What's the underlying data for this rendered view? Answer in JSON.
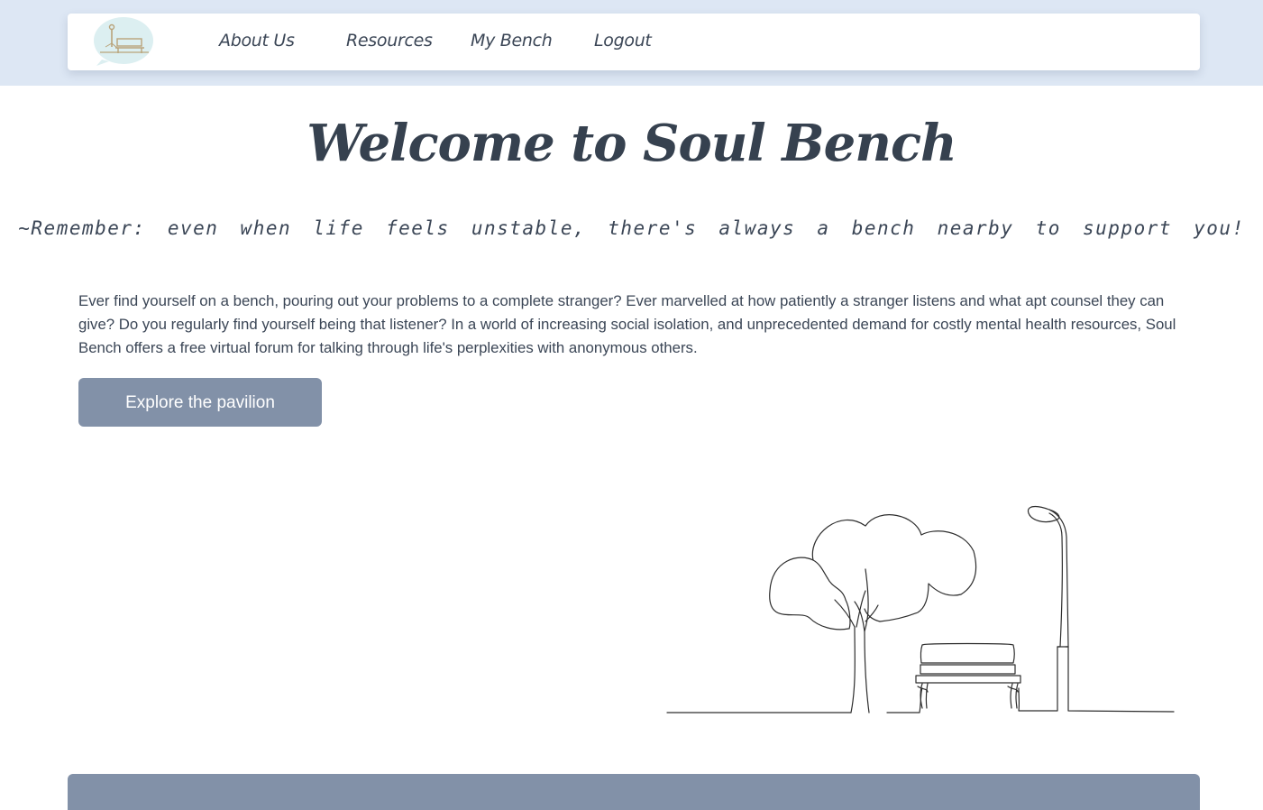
{
  "nav": {
    "links": [
      {
        "label": "About Us"
      },
      {
        "label": "Resources"
      },
      {
        "label": "My Bench"
      },
      {
        "label": "Logout"
      }
    ],
    "logo_icon": "bench-logo-icon"
  },
  "hero": {
    "title": "Welcome to Soul Bench",
    "subtitle": "~Remember: even when life feels unstable, there's always a bench nearby to support you!"
  },
  "intro": {
    "text": "Ever find yourself on a bench, pouring out your problems to a complete stranger? Ever marvelled at how patiently a stranger listens and what apt counsel they can give? Do you regularly find yourself being that listener? In a world of increasing social isolation, and unprecedented demand for costly mental health resources, Soul Bench offers a free virtual forum for talking through life's perplexities with anonymous others."
  },
  "cta": {
    "label": "Explore the pavilion"
  },
  "illustration": {
    "icon": "park-bench-line-drawing"
  },
  "colors": {
    "top_band": "#dde7f4",
    "button": "#8291a8",
    "text": "#3b4656"
  }
}
